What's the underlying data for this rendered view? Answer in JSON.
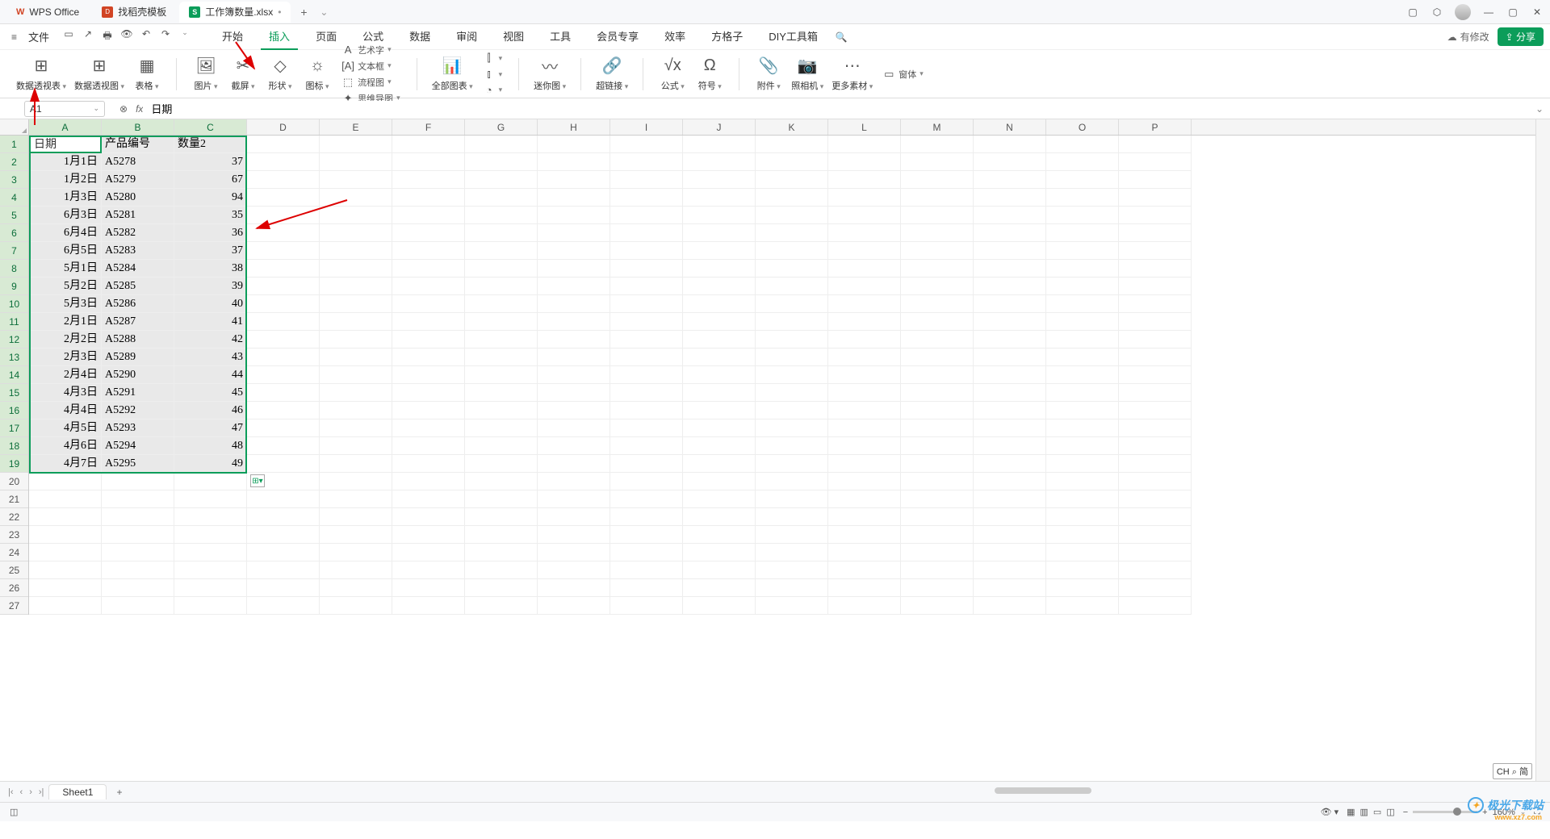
{
  "title_bar": {
    "tabs": [
      {
        "label": "WPS Office",
        "type": "wps"
      },
      {
        "label": "找稻壳模板",
        "type": "doc"
      },
      {
        "label": "工作簿数量.xlsx",
        "type": "sheet",
        "modified": "•"
      }
    ],
    "add": "+"
  },
  "menu": {
    "file": "文件",
    "quick": [
      "↗",
      "🖶",
      "⎙",
      "↶",
      "↷"
    ],
    "tabs": [
      "开始",
      "插入",
      "页面",
      "公式",
      "数据",
      "审阅",
      "视图",
      "工具",
      "会员专享",
      "效率",
      "方格子",
      "DIY工具箱"
    ],
    "active_tab_index": 1,
    "modify": "有修改",
    "share": "分享"
  },
  "ribbon": {
    "groups": [
      {
        "large": [
          {
            "icon": "⊞",
            "label": "数据透视表"
          },
          {
            "icon": "⊞",
            "label": "数据透视图"
          },
          {
            "icon": "▦",
            "label": "表格"
          }
        ]
      },
      {
        "large": [
          {
            "icon": "🖼",
            "label": "图片"
          },
          {
            "icon": "✂",
            "label": "截屏"
          },
          {
            "icon": "◇",
            "label": "形状"
          },
          {
            "icon": "☼",
            "label": "图标"
          }
        ],
        "small": [
          {
            "icon": "A",
            "label": "艺术字"
          },
          {
            "icon": "[A]",
            "label": "文本框"
          },
          {
            "icon": "⬚",
            "label": "流程图"
          },
          {
            "icon": "✦",
            "label": "思维导图"
          }
        ]
      },
      {
        "large": [
          {
            "icon": "📊",
            "label": "全部图表"
          }
        ],
        "small2": [
          {
            "icon": "⫿",
            "label": ""
          },
          {
            "icon": "⫾",
            "label": ""
          },
          {
            "icon": "◔",
            "label": ""
          }
        ]
      },
      {
        "large": [
          {
            "icon": "〰",
            "label": "迷你图"
          }
        ]
      },
      {
        "large": [
          {
            "icon": "🔗",
            "label": "超链接"
          }
        ]
      },
      {
        "large": [
          {
            "icon": "√x",
            "label": "公式"
          },
          {
            "icon": "Ω",
            "label": "符号"
          }
        ]
      },
      {
        "large": [
          {
            "icon": "📎",
            "label": "附件"
          },
          {
            "icon": "📷",
            "label": "照相机"
          },
          {
            "icon": "⋯",
            "label": "更多素材"
          }
        ],
        "small3": [
          {
            "icon": "▭",
            "label": "窗体"
          }
        ]
      }
    ]
  },
  "formula_bar": {
    "name_box": "A1",
    "fx": "fx",
    "content": "日期"
  },
  "columns": [
    "A",
    "B",
    "C",
    "D",
    "E",
    "F",
    "G",
    "H",
    "I",
    "J",
    "K",
    "L",
    "M",
    "N",
    "O",
    "P"
  ],
  "selected_cols": 3,
  "rows": 27,
  "selected_rows": 19,
  "data": {
    "headers": [
      "日期",
      "产品编号",
      "数量2"
    ],
    "rows": [
      [
        "1月1日",
        "A5278",
        "37"
      ],
      [
        "1月2日",
        "A5279",
        "67"
      ],
      [
        "1月3日",
        "A5280",
        "94"
      ],
      [
        "6月3日",
        "A5281",
        "35"
      ],
      [
        "6月4日",
        "A5282",
        "36"
      ],
      [
        "6月5日",
        "A5283",
        "37"
      ],
      [
        "5月1日",
        "A5284",
        "38"
      ],
      [
        "5月2日",
        "A5285",
        "39"
      ],
      [
        "5月3日",
        "A5286",
        "40"
      ],
      [
        "2月1日",
        "A5287",
        "41"
      ],
      [
        "2月2日",
        "A5288",
        "42"
      ],
      [
        "2月3日",
        "A5289",
        "43"
      ],
      [
        "2月4日",
        "A5290",
        "44"
      ],
      [
        "4月3日",
        "A5291",
        "45"
      ],
      [
        "4月4日",
        "A5292",
        "46"
      ],
      [
        "4月5日",
        "A5293",
        "47"
      ],
      [
        "4月6日",
        "A5294",
        "48"
      ],
      [
        "4月7日",
        "A5295",
        "49"
      ]
    ]
  },
  "sheet_tabs": {
    "active": "Sheet1"
  },
  "status": {
    "indicator": "◫",
    "zoom": "160%",
    "ime": "CH ⌕ 简"
  },
  "watermark": {
    "text": "极光下载站",
    "sub": "www.xz7.com"
  }
}
